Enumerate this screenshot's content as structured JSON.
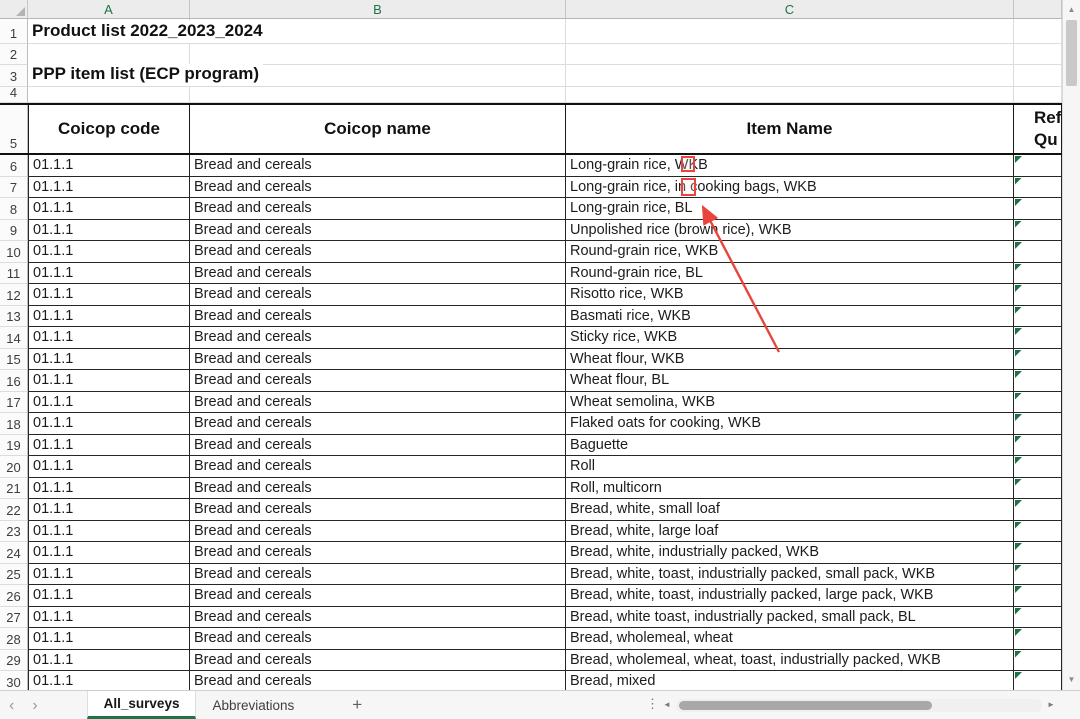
{
  "colors": {
    "excel_green": "#217346",
    "annotation_red": "#e8453c"
  },
  "column_headers": {
    "a": "A",
    "b": "B",
    "c": "C"
  },
  "row_numbers": {
    "r1": "1",
    "r2": "2",
    "r3": "3",
    "r4": "4",
    "r5": "5"
  },
  "titles": {
    "product_list": "Product list 2022_2023_2024",
    "ppp_item_list": "PPP item list (ECP program)"
  },
  "table": {
    "headers": {
      "code": "Coicop code",
      "name": "Coicop name",
      "item": "Item Name",
      "ref1": "Ref",
      "ref2": "Qu"
    },
    "rows": [
      {
        "n": "6",
        "code": "01.1.1",
        "name": "Bread and cereals",
        "item": "Long-grain rice, WKB"
      },
      {
        "n": "7",
        "code": "01.1.1",
        "name": "Bread and cereals",
        "item": "Long-grain rice, in cooking bags, WKB"
      },
      {
        "n": "8",
        "code": "01.1.1",
        "name": "Bread and cereals",
        "item": "Long-grain rice, BL"
      },
      {
        "n": "9",
        "code": "01.1.1",
        "name": "Bread and cereals",
        "item": "Unpolished rice (brown rice), WKB"
      },
      {
        "n": "10",
        "code": "01.1.1",
        "name": "Bread and cereals",
        "item": "Round-grain rice, WKB"
      },
      {
        "n": "11",
        "code": "01.1.1",
        "name": "Bread and cereals",
        "item": "Round-grain rice, BL"
      },
      {
        "n": "12",
        "code": "01.1.1",
        "name": "Bread and cereals",
        "item": "Risotto rice, WKB"
      },
      {
        "n": "13",
        "code": "01.1.1",
        "name": "Bread and cereals",
        "item": "Basmati rice, WKB"
      },
      {
        "n": "14",
        "code": "01.1.1",
        "name": "Bread and cereals",
        "item": "Sticky rice, WKB"
      },
      {
        "n": "15",
        "code": "01.1.1",
        "name": "Bread and cereals",
        "item": "Wheat flour, WKB"
      },
      {
        "n": "16",
        "code": "01.1.1",
        "name": "Bread and cereals",
        "item": "Wheat flour, BL"
      },
      {
        "n": "17",
        "code": "01.1.1",
        "name": "Bread and cereals",
        "item": "Wheat semolina, WKB"
      },
      {
        "n": "18",
        "code": "01.1.1",
        "name": "Bread and cereals",
        "item": "Flaked oats for cooking, WKB"
      },
      {
        "n": "19",
        "code": "01.1.1",
        "name": "Bread and cereals",
        "item": "Baguette"
      },
      {
        "n": "20",
        "code": "01.1.1",
        "name": "Bread and cereals",
        "item": "Roll"
      },
      {
        "n": "21",
        "code": "01.1.1",
        "name": "Bread and cereals",
        "item": "Roll, multicorn"
      },
      {
        "n": "22",
        "code": "01.1.1",
        "name": "Bread and cereals",
        "item": "Bread, white, small loaf"
      },
      {
        "n": "23",
        "code": "01.1.1",
        "name": "Bread and cereals",
        "item": "Bread, white, large loaf"
      },
      {
        "n": "24",
        "code": "01.1.1",
        "name": "Bread and cereals",
        "item": "Bread, white, industrially packed, WKB"
      },
      {
        "n": "25",
        "code": "01.1.1",
        "name": "Bread and cereals",
        "item": "Bread, white, toast, industrially packed, small pack, WKB"
      },
      {
        "n": "26",
        "code": "01.1.1",
        "name": "Bread and cereals",
        "item": "Bread, white, toast, industrially packed, large pack, WKB"
      },
      {
        "n": "27",
        "code": "01.1.1",
        "name": "Bread and cereals",
        "item": "Bread, white toast, industrially packed, small pack, BL"
      },
      {
        "n": "28",
        "code": "01.1.1",
        "name": "Bread and cereals",
        "item": "Bread, wholemeal, wheat"
      },
      {
        "n": "29",
        "code": "01.1.1",
        "name": "Bread and cereals",
        "item": "Bread, wholemeal, wheat, toast, industrially packed, WKB"
      },
      {
        "n": "30",
        "code": "01.1.1",
        "name": "Bread and cereals",
        "item": "Bread, mixed"
      }
    ]
  },
  "sheet_tabs": {
    "active": "All_surveys",
    "other": "Abbreviations",
    "add_label": "+"
  },
  "nav": {
    "prev": "‹",
    "next": "›",
    "more": "⋮"
  },
  "scrollbar": {
    "up": "▲",
    "down": "▼",
    "left": "◄",
    "right": "►"
  }
}
